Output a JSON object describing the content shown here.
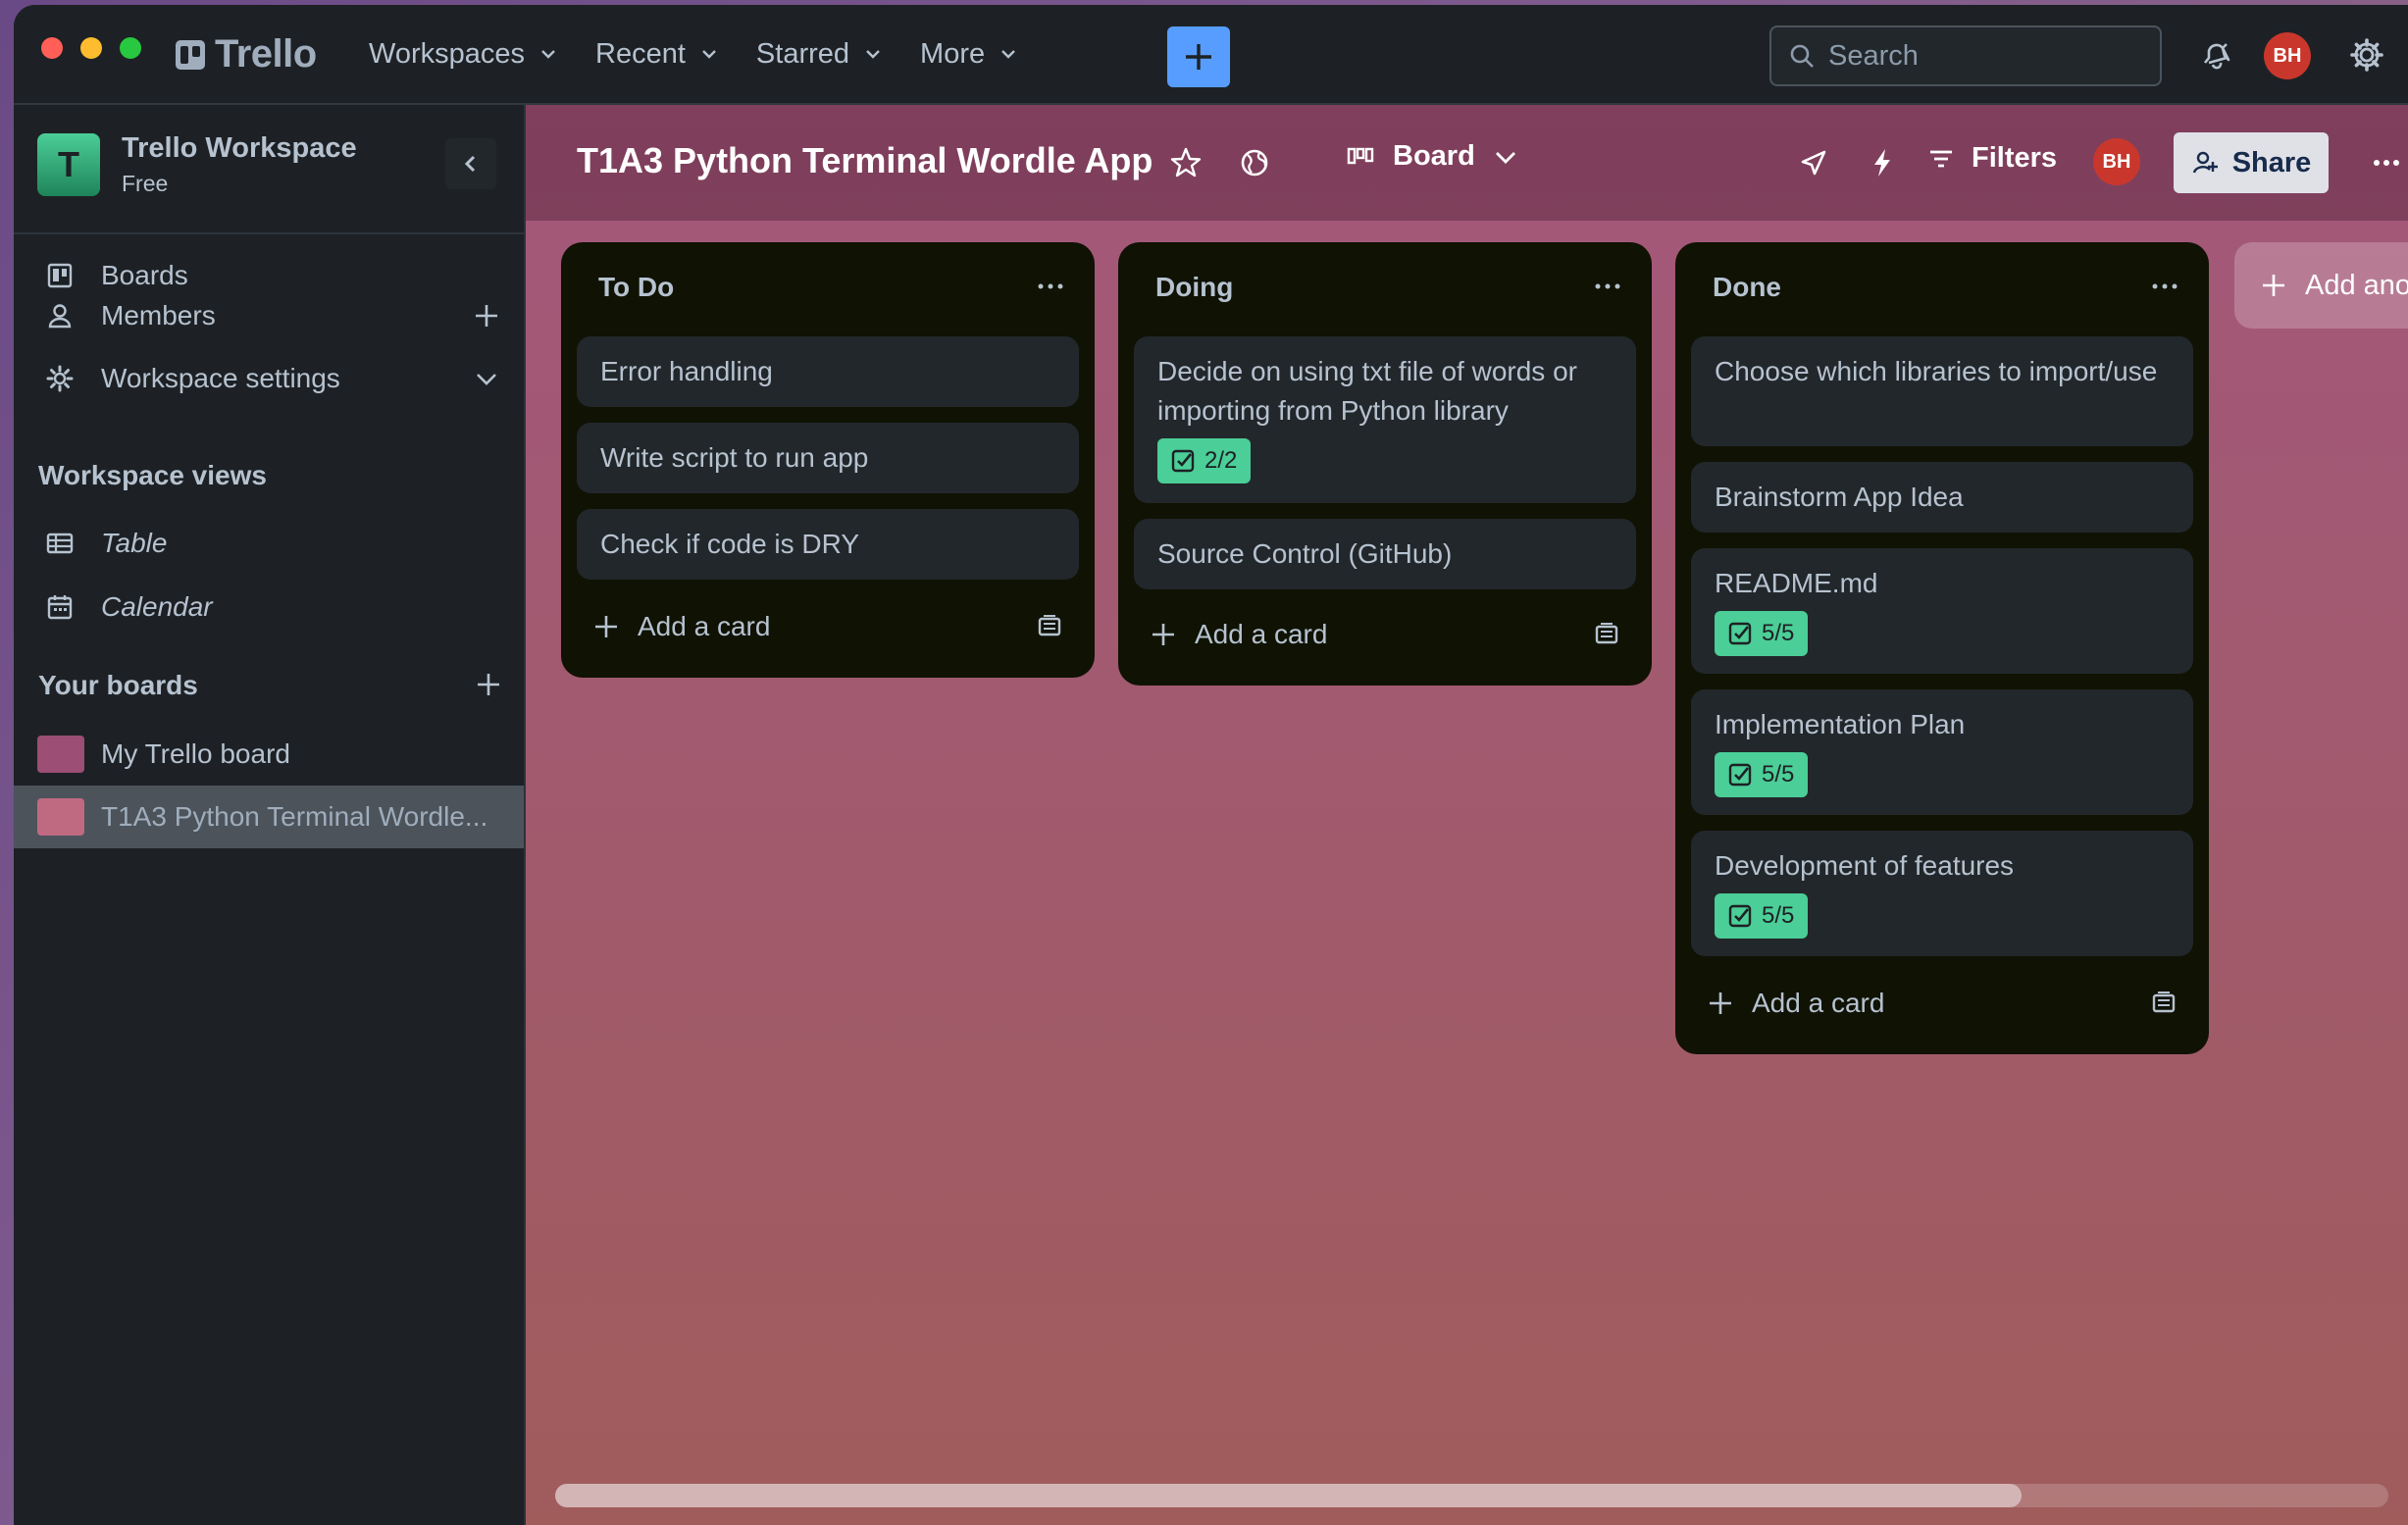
{
  "app": {
    "logo_text": "Trello"
  },
  "topbar": {
    "nav": [
      "Workspaces",
      "Recent",
      "Starred",
      "More"
    ],
    "create_icon": "plus-icon",
    "search_placeholder": "Search",
    "notifications_icon": "bell-icon",
    "avatar_initials": "BH",
    "settings_icon": "gear-icon"
  },
  "sidebar": {
    "workspace_initial": "T",
    "workspace_name": "Trello Workspace",
    "workspace_plan": "Free",
    "items": [
      {
        "label": "Boards",
        "icon": "board-icon"
      },
      {
        "label": "Members",
        "icon": "person-icon"
      },
      {
        "label": "Workspace settings",
        "icon": "gear-icon"
      }
    ],
    "views_heading": "Workspace views",
    "views": [
      {
        "label": "Table",
        "icon": "table-icon"
      },
      {
        "label": "Calendar",
        "icon": "calendar-icon"
      }
    ],
    "boards_heading": "Your boards",
    "boards": [
      {
        "label": "My Trello board",
        "color": "#9c4e74"
      },
      {
        "label": "T1A3 Python Terminal Wordle...",
        "color": "#c06a82"
      }
    ]
  },
  "board": {
    "title": "T1A3 Python Terminal Wordle App",
    "view_label": "Board",
    "filters_label": "Filters",
    "member_initials": "BH",
    "share_label": "Share",
    "add_list_label": "Add another list",
    "horizontal_scroll_fraction": 0.8,
    "lists": [
      {
        "title": "To Do",
        "cards": [
          {
            "title": "Error handling"
          },
          {
            "title": "Write script to run app"
          },
          {
            "title": "Check if code is DRY"
          }
        ],
        "add_label": "Add a card"
      },
      {
        "title": "Doing",
        "cards": [
          {
            "title": "Decide on using txt file of words or importing from Python library",
            "checklist": "2/2"
          },
          {
            "title": "Source Control (GitHub)"
          }
        ],
        "add_label": "Add a card"
      },
      {
        "title": "Done",
        "cards": [
          {
            "title": "Choose which libraries to import/use"
          },
          {
            "title": "Brainstorm App Idea"
          },
          {
            "title": "README.md",
            "checklist": "5/5"
          },
          {
            "title": "Implementation Plan",
            "checklist": "5/5"
          },
          {
            "title": "Development of features",
            "checklist": "5/5"
          }
        ],
        "add_label": "Add a card"
      }
    ]
  },
  "colors": {
    "accent": "#579dff",
    "checklist_complete": "#4bce97",
    "avatar": "#c9372c"
  }
}
